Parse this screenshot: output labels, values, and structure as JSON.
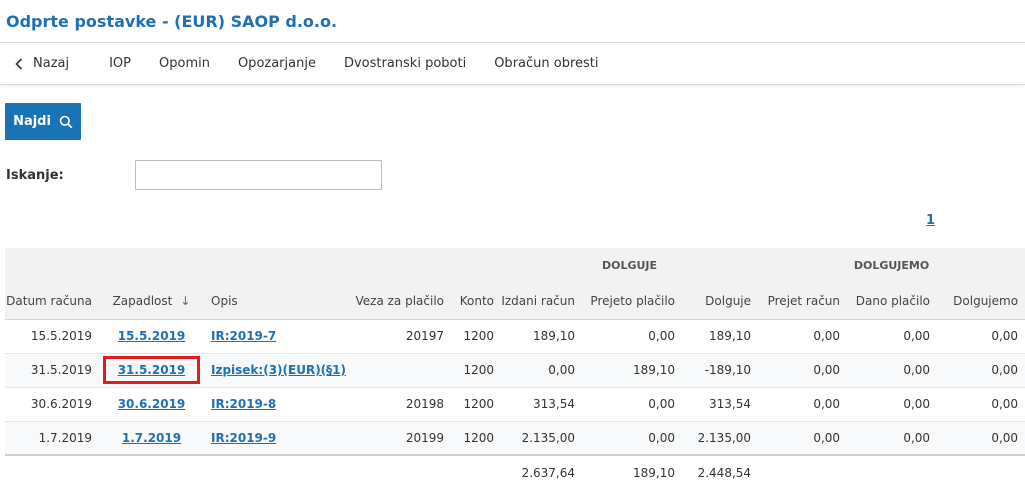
{
  "page": {
    "title": "Odprte postavke - (EUR) SAOP d.o.o."
  },
  "toolbar": {
    "back_icon": "chevron-left-icon",
    "back_label": "Nazaj",
    "items": [
      "IOP",
      "Opomin",
      "Opozarjanje",
      "Dvostranski poboti",
      "Obračun obresti"
    ]
  },
  "find": {
    "label": "Najdi",
    "icon": "search-icon"
  },
  "search": {
    "label": "Iskanje:",
    "value": "",
    "placeholder": ""
  },
  "pager": {
    "current": "1"
  },
  "table": {
    "groups": {
      "dolguje": "DOLGUJE",
      "dolgujemo": "DOLGUJEMO"
    },
    "columns": [
      "Datum računa",
      "Zapadlost",
      "Opis",
      "Veza za plačilo",
      "Konto",
      "Izdani račun",
      "Prejeto plačilo",
      "Dolguje",
      "Prejet račun",
      "Dano plačilo",
      "Dolgujemo"
    ],
    "sort_indicator": "↓",
    "rows": [
      {
        "datum": "15.5.2019",
        "zapadlost": "15.5.2019",
        "opis": "IR:2019-7",
        "veza": "20197",
        "konto": "1200",
        "izdani": "189,10",
        "prejeto": "0,00",
        "dolguje": "189,10",
        "prejet_racun": "0,00",
        "dano": "0,00",
        "dolgujemo": "0,00"
      },
      {
        "datum": "31.5.2019",
        "zapadlost": "31.5.2019",
        "opis": "Izpisek:(3)(EUR)(§1)",
        "veza": "",
        "konto": "1200",
        "izdani": "0,00",
        "prejeto": "189,10",
        "dolguje": "-189,10",
        "prejet_racun": "0,00",
        "dano": "0,00",
        "dolgujemo": "0,00"
      },
      {
        "datum": "30.6.2019",
        "zapadlost": "30.6.2019",
        "opis": "IR:2019-8",
        "veza": "20198",
        "konto": "1200",
        "izdani": "313,54",
        "prejeto": "0,00",
        "dolguje": "313,54",
        "prejet_racun": "0,00",
        "dano": "0,00",
        "dolgujemo": "0,00"
      },
      {
        "datum": "1.7.2019",
        "zapadlost": "1.7.2019",
        "opis": "IR:2019-9",
        "veza": "20199",
        "konto": "1200",
        "izdani": "2.135,00",
        "prejeto": "0,00",
        "dolguje": "2.135,00",
        "prejet_racun": "0,00",
        "dano": "0,00",
        "dolgujemo": "0,00"
      }
    ],
    "totals": {
      "izdani": "2.637,64",
      "prejeto": "189,10",
      "dolguje": "2.448,54"
    }
  },
  "colors": {
    "accent": "#1f70b3",
    "button": "#1a73b6",
    "highlight": "#e01b22"
  }
}
